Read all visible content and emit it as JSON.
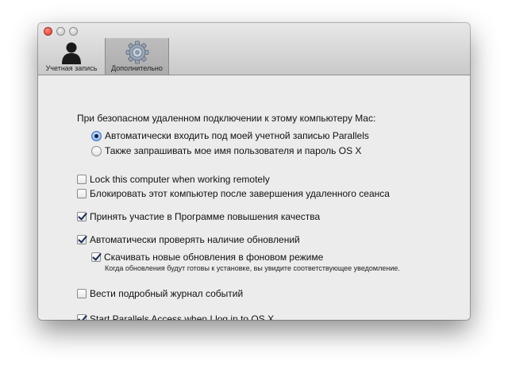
{
  "tabs": [
    {
      "label": "Учетная запись",
      "icon": "user-silhouette-icon"
    },
    {
      "label": "Дополнительно",
      "icon": "gear-icon",
      "selected": true
    }
  ],
  "remote_connection": {
    "heading": "При безопасном удаленном подключении к этому компьютеру Mac:",
    "options": [
      {
        "label": "Автоматически входить под моей учетной записью Parallels",
        "selected": true
      },
      {
        "label": "Также запрашивать мое имя пользователя и пароль OS X",
        "selected": false
      }
    ]
  },
  "checkboxes": {
    "lock_computer": {
      "label": "Lock this computer when working remotely",
      "checked": false
    },
    "block_after_session": {
      "label": "Блокировать этот компьютер после завершения удаленного сеанса",
      "checked": false
    },
    "quality_program": {
      "label": "Принять участие в Программе повышения качества",
      "checked": true
    },
    "check_updates": {
      "label": "Автоматически проверять наличие обновлений",
      "checked": true
    },
    "download_updates": {
      "label": "Скачивать новые обновления в фоновом режиме",
      "checked": true,
      "note": "Когда обновления будут готовы к установке, вы увидите соответствующее уведомление."
    },
    "detailed_log": {
      "label": "Вести подробный журнал событий",
      "checked": false
    },
    "start_on_login": {
      "label": "Start Parallels Access when I log in to OS X",
      "checked": true
    }
  }
}
